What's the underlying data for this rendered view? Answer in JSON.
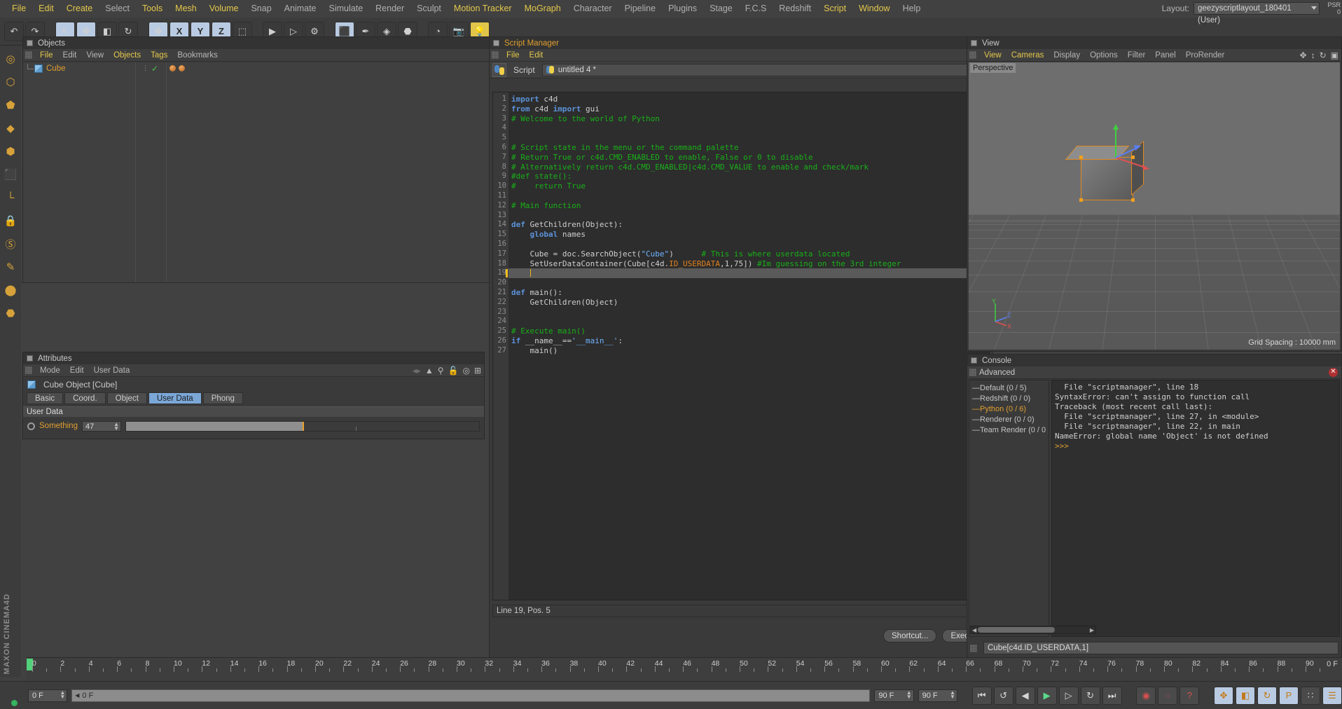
{
  "menubar": {
    "items": [
      {
        "label": "File",
        "hl": true
      },
      {
        "label": "Edit",
        "hl": true
      },
      {
        "label": "Create",
        "hl": true
      },
      {
        "label": "Select",
        "hl": false
      },
      {
        "label": "Tools",
        "hl": true
      },
      {
        "label": "Mesh",
        "hl": true
      },
      {
        "label": "Volume",
        "hl": true
      },
      {
        "label": "Snap",
        "hl": false
      },
      {
        "label": "Animate",
        "hl": false
      },
      {
        "label": "Simulate",
        "hl": false
      },
      {
        "label": "Render",
        "hl": false
      },
      {
        "label": "Sculpt",
        "hl": false
      },
      {
        "label": "Motion Tracker",
        "hl": true
      },
      {
        "label": "MoGraph",
        "hl": true
      },
      {
        "label": "Character",
        "hl": false
      },
      {
        "label": "Pipeline",
        "hl": false
      },
      {
        "label": "Plugins",
        "hl": false
      },
      {
        "label": "Stage",
        "hl": false
      },
      {
        "label": "F.C.S",
        "hl": false
      },
      {
        "label": "Redshift",
        "hl": false
      },
      {
        "label": "Script",
        "hl": true
      },
      {
        "label": "Window",
        "hl": true
      },
      {
        "label": "Help",
        "hl": false
      }
    ],
    "layout_label": "Layout:",
    "layout_value": "geezyscriptlayout_180401 (User)",
    "psr_line1": "PSR",
    "psr_line2": "0"
  },
  "toolbar": {
    "buttons": [
      {
        "name": "undo-button",
        "glyph": "↶",
        "style": "dark"
      },
      {
        "name": "redo-button",
        "glyph": "↷",
        "style": "dark"
      },
      {
        "name": "gap",
        "glyph": "",
        "style": "gap"
      },
      {
        "name": "live-selection-tool",
        "glyph": "↖",
        "style": "blue"
      },
      {
        "name": "move-tool",
        "glyph": "✥",
        "style": "blue"
      },
      {
        "name": "scale-tool",
        "glyph": "◧",
        "style": "dark"
      },
      {
        "name": "rotate-tool",
        "glyph": "↻",
        "style": "dark"
      },
      {
        "name": "gap2",
        "glyph": "",
        "style": "gap"
      },
      {
        "name": "move-axis-tool",
        "glyph": "✥",
        "style": "blue"
      },
      {
        "name": "axis-x-toggle",
        "glyph": "X",
        "style": "axis"
      },
      {
        "name": "axis-y-toggle",
        "glyph": "Y",
        "style": "axis"
      },
      {
        "name": "axis-z-toggle",
        "glyph": "Z",
        "style": "axis"
      },
      {
        "name": "world-coordinate-toggle",
        "glyph": "⬚",
        "style": "dark"
      },
      {
        "name": "gap3",
        "glyph": "",
        "style": "gap"
      },
      {
        "name": "render-view-button",
        "glyph": "▶",
        "style": "dark"
      },
      {
        "name": "render-region-button",
        "glyph": "▷",
        "style": "dark"
      },
      {
        "name": "render-settings-button",
        "glyph": "⚙",
        "style": "dark"
      },
      {
        "name": "gap4",
        "glyph": "",
        "style": "gap"
      },
      {
        "name": "cube-primitive-button",
        "glyph": "⬛",
        "style": "blue"
      },
      {
        "name": "spline-pen-button",
        "glyph": "✒",
        "style": "dark"
      },
      {
        "name": "generator-button",
        "glyph": "◈",
        "style": "dark"
      },
      {
        "name": "deformer-button",
        "glyph": "⬣",
        "style": "dark"
      },
      {
        "name": "gap5",
        "glyph": "",
        "style": "gap"
      },
      {
        "name": "environment-button",
        "glyph": "◔",
        "style": "dark"
      },
      {
        "name": "camera-button",
        "glyph": "📷",
        "style": "dark"
      },
      {
        "name": "light-button",
        "glyph": "💡",
        "style": "yellow"
      }
    ]
  },
  "lefttoolbar": {
    "buttons": [
      {
        "name": "texture-tool-icon",
        "glyph": "◎"
      },
      {
        "name": "point-mode-icon",
        "glyph": "⬡"
      },
      {
        "name": "edge-mode-icon",
        "glyph": "⬟"
      },
      {
        "name": "polygon-mode-icon",
        "glyph": "◆"
      },
      {
        "name": "model-mode-icon",
        "glyph": "⬢"
      },
      {
        "name": "object-mode-icon",
        "glyph": "⬛"
      },
      {
        "name": "workplane-icon",
        "glyph": "└"
      },
      {
        "name": "lock-axis-icon",
        "glyph": "🔒"
      },
      {
        "name": "snap-icon",
        "glyph": "Ⓢ"
      },
      {
        "name": "guide-icon",
        "glyph": "✎"
      },
      {
        "name": "enable-axis-icon",
        "glyph": "⬤"
      },
      {
        "name": "lock-icon",
        "glyph": "⬣"
      }
    ],
    "brand": "MAXON CINEMA4D"
  },
  "objects_panel": {
    "title": "Objects",
    "menu": [
      {
        "label": "File",
        "hl": true
      },
      {
        "label": "Edit",
        "hl": false
      },
      {
        "label": "View",
        "hl": false
      },
      {
        "label": "Objects",
        "hl": true
      },
      {
        "label": "Tags",
        "hl": true
      },
      {
        "label": "Bookmarks",
        "hl": false
      }
    ],
    "icons": [
      "search-icon",
      "home-icon",
      "oval-icon",
      "layout-icon"
    ],
    "rows": [
      {
        "name": "Cube"
      }
    ]
  },
  "attributes_panel": {
    "title": "Attributes",
    "menu": [
      {
        "label": "Mode",
        "hl": false
      },
      {
        "label": "Edit",
        "hl": false
      },
      {
        "label": "User Data",
        "hl": false
      }
    ],
    "icons": [
      "arrow-up-icon",
      "search-icon",
      "lock-icon",
      "target-icon",
      "plus-icon"
    ],
    "object_label": "Cube Object [Cube]",
    "tabs": [
      {
        "label": "Basic",
        "active": false
      },
      {
        "label": "Coord.",
        "active": false
      },
      {
        "label": "Object",
        "active": false
      },
      {
        "label": "User Data",
        "active": true
      },
      {
        "label": "Phong",
        "active": false
      }
    ],
    "group_header": "User Data",
    "userdata": {
      "label": "Something",
      "value": "47",
      "slider_percent": 50
    }
  },
  "script_manager": {
    "title": "Script Manager",
    "menu": [
      {
        "label": "File",
        "hl": true
      },
      {
        "label": "Edit",
        "hl": true
      }
    ],
    "script_label": "Script",
    "script_name": "untitled 4 *",
    "status": "Line 19, Pos. 5",
    "buttons": [
      {
        "label": "Shortcut...",
        "name": "shortcut-button"
      },
      {
        "label": "Execute",
        "name": "execute-button"
      }
    ],
    "code_lines": [
      {
        "n": 1,
        "tokens": [
          {
            "t": "import ",
            "c": "kw"
          },
          {
            "t": "c4d",
            "c": "fn"
          }
        ]
      },
      {
        "n": 2,
        "tokens": [
          {
            "t": "from ",
            "c": "kw"
          },
          {
            "t": "c4d ",
            "c": "fn"
          },
          {
            "t": "import ",
            "c": "kw"
          },
          {
            "t": "gui",
            "c": "fn"
          }
        ]
      },
      {
        "n": 3,
        "tokens": [
          {
            "t": "# Welcome to the world of Python",
            "c": "cm"
          }
        ]
      },
      {
        "n": 4,
        "tokens": []
      },
      {
        "n": 5,
        "tokens": []
      },
      {
        "n": 6,
        "tokens": [
          {
            "t": "# Script state in the menu or the command palette",
            "c": "cm"
          }
        ]
      },
      {
        "n": 7,
        "tokens": [
          {
            "t": "# Return True or c4d.CMD_ENABLED to enable, False or 0 to disable",
            "c": "cm"
          }
        ]
      },
      {
        "n": 8,
        "tokens": [
          {
            "t": "# Alternatively return c4d.CMD_ENABLED|c4d.CMD_VALUE to enable and check/mark",
            "c": "cm"
          }
        ]
      },
      {
        "n": 9,
        "tokens": [
          {
            "t": "#def state():",
            "c": "cm"
          }
        ]
      },
      {
        "n": 10,
        "tokens": [
          {
            "t": "#    return True",
            "c": "cm"
          }
        ]
      },
      {
        "n": 11,
        "tokens": []
      },
      {
        "n": 12,
        "tokens": [
          {
            "t": "# Main function",
            "c": "cm"
          }
        ]
      },
      {
        "n": 13,
        "tokens": []
      },
      {
        "n": 14,
        "tokens": [
          {
            "t": "def ",
            "c": "kw"
          },
          {
            "t": "GetChildren(Object):",
            "c": "fn"
          }
        ]
      },
      {
        "n": 15,
        "tokens": [
          {
            "t": "    ",
            "c": "fn"
          },
          {
            "t": "global ",
            "c": "kw"
          },
          {
            "t": "names",
            "c": "fn"
          }
        ]
      },
      {
        "n": 16,
        "tokens": []
      },
      {
        "n": 17,
        "tokens": [
          {
            "t": "    Cube = doc.SearchObject(",
            "c": "fn"
          },
          {
            "t": "\"Cube\"",
            "c": "str"
          },
          {
            "t": ")      ",
            "c": "fn"
          },
          {
            "t": "# This is where userdata located",
            "c": "cm"
          }
        ]
      },
      {
        "n": 18,
        "tokens": [
          {
            "t": "    SetUserDataContainer(Cube[c4d.",
            "c": "fn"
          },
          {
            "t": "ID_USERDATA",
            "c": "ud"
          },
          {
            "t": ",1,75]) ",
            "c": "fn"
          },
          {
            "t": "#Im guessing on the 3rd integer",
            "c": "cm"
          }
        ]
      },
      {
        "n": 19,
        "tokens": [],
        "current": true
      },
      {
        "n": 20,
        "tokens": []
      },
      {
        "n": 21,
        "tokens": [
          {
            "t": "def ",
            "c": "kw"
          },
          {
            "t": "main():",
            "c": "fn"
          }
        ]
      },
      {
        "n": 22,
        "tokens": [
          {
            "t": "    GetChildren(Object)",
            "c": "fn"
          }
        ]
      },
      {
        "n": 23,
        "tokens": []
      },
      {
        "n": 24,
        "tokens": []
      },
      {
        "n": 25,
        "tokens": [
          {
            "t": "# Execute main()",
            "c": "cm"
          }
        ]
      },
      {
        "n": 26,
        "tokens": [
          {
            "t": "if ",
            "c": "kw"
          },
          {
            "t": "__name__==",
            "c": "fn"
          },
          {
            "t": "'__main__'",
            "c": "str"
          },
          {
            "t": ":",
            "c": "fn"
          }
        ]
      },
      {
        "n": 27,
        "tokens": [
          {
            "t": "    main()",
            "c": "fn"
          }
        ]
      }
    ]
  },
  "view_panel": {
    "title": "View",
    "menu": [
      {
        "label": "View",
        "hl": true
      },
      {
        "label": "Cameras",
        "hl": true
      },
      {
        "label": "Display",
        "hl": false
      },
      {
        "label": "Options",
        "hl": false
      },
      {
        "label": "Filter",
        "hl": false
      },
      {
        "label": "Panel",
        "hl": false
      },
      {
        "label": "ProRender",
        "hl": false
      }
    ],
    "icons": [
      "move-camera-icon",
      "pan-camera-icon",
      "rotate-camera-icon",
      "maximize-icon",
      "layout-icon"
    ],
    "viewport_label": "Perspective",
    "grid_spacing": "Grid Spacing : 10000 mm",
    "axis_labels": {
      "x": "X",
      "y": "Y",
      "z": "Z"
    }
  },
  "console_panel": {
    "title": "Console",
    "tab_label": "Advanced",
    "tree": [
      {
        "label": "Default (0 / 5)",
        "hl": false
      },
      {
        "label": "Redshift (0 / 0)",
        "hl": false
      },
      {
        "label": "Python (0 / 6)",
        "hl": true
      },
      {
        "label": "Renderer (0 / 0)",
        "hl": false
      },
      {
        "label": "Team Render (0 / 0",
        "hl": false
      }
    ],
    "output": [
      {
        "text": "  File \"scriptmanager\", line 18",
        "prompt": false
      },
      {
        "text": "SyntaxError: can't assign to function call",
        "prompt": false
      },
      {
        "text": "Traceback (most recent call last):",
        "prompt": false
      },
      {
        "text": "  File \"scriptmanager\", line 27, in <module>",
        "prompt": false
      },
      {
        "text": "  File \"scriptmanager\", line 22, in main",
        "prompt": false
      },
      {
        "text": "NameError: global name 'Object' is not defined",
        "prompt": false
      },
      {
        "text": ">>>",
        "prompt": true
      }
    ],
    "input_value": "Cube[c4d.ID_USERDATA,1]"
  },
  "timeline": {
    "ticks": [
      0,
      2,
      4,
      6,
      8,
      10,
      12,
      14,
      16,
      18,
      20,
      22,
      24,
      26,
      28,
      30,
      32,
      34,
      36,
      38,
      40,
      42,
      44,
      46,
      48,
      50,
      52,
      54,
      56,
      58,
      60,
      62,
      64,
      66,
      68,
      70,
      72,
      74,
      76,
      78,
      80,
      82,
      84,
      86,
      88,
      90
    ],
    "end_label": "0 F"
  },
  "bottombar": {
    "current_frame": "0 F",
    "track_label": "0 F",
    "end_frame": "90 F",
    "preview_end": "90 F",
    "transport": [
      {
        "name": "go-to-start-button",
        "glyph": "⏮",
        "style": ""
      },
      {
        "name": "play-reverse-loop-button",
        "glyph": "↺",
        "style": ""
      },
      {
        "name": "step-back-button",
        "glyph": "◀",
        "style": ""
      },
      {
        "name": "play-button",
        "glyph": "▶",
        "style": "play"
      },
      {
        "name": "step-forward-button",
        "glyph": "▷",
        "style": ""
      },
      {
        "name": "play-forward-loop-button",
        "glyph": "↻",
        "style": ""
      },
      {
        "name": "go-to-end-button",
        "glyph": "⏭",
        "style": ""
      }
    ],
    "keyframe_buttons": [
      {
        "name": "record-keyframe-button",
        "glyph": "◉",
        "style": "red"
      },
      {
        "name": "autokey-button",
        "glyph": "◌",
        "style": "red"
      },
      {
        "name": "keyframe-selection-button",
        "glyph": "?",
        "style": "red"
      }
    ],
    "param_buttons": [
      {
        "name": "position-key-button",
        "glyph": "✥",
        "style": "blue"
      },
      {
        "name": "scale-key-button",
        "glyph": "◧",
        "style": "blue"
      },
      {
        "name": "rotation-key-button",
        "glyph": "↻",
        "style": "blue"
      },
      {
        "name": "parameter-key-button",
        "glyph": "P",
        "style": "blue"
      },
      {
        "name": "point-level-animation-button",
        "glyph": "∷",
        "style": ""
      },
      {
        "name": "timeline-button",
        "glyph": "☰",
        "style": "blue"
      }
    ]
  }
}
